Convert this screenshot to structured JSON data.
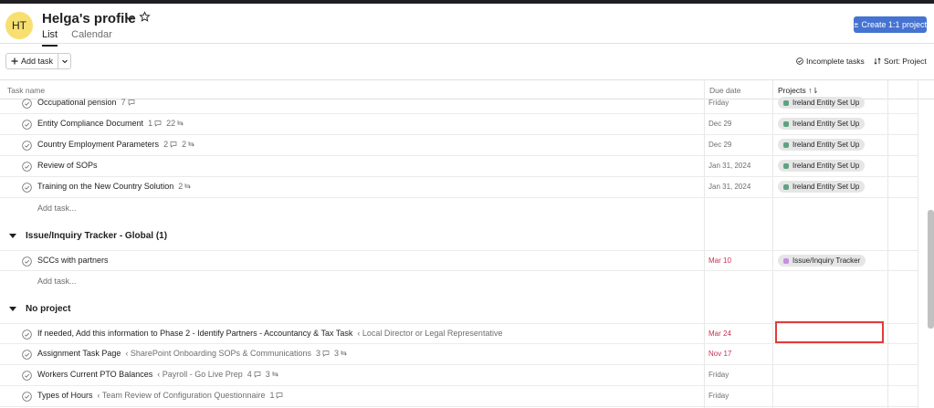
{
  "header": {
    "avatar_initials": "HT",
    "title": "Helga's profile",
    "tabs": [
      {
        "label": "List",
        "active": true
      },
      {
        "label": "Calendar",
        "active": false
      }
    ],
    "create_button_label": "Create 1:1 project"
  },
  "toolbar": {
    "add_task_label": "Add task",
    "filter_label": "Incomplete tasks",
    "sort_label": "Sort: Project"
  },
  "columns": {
    "task_name": "Task name",
    "due_date": "Due date",
    "projects": "Projects"
  },
  "groups": [
    {
      "tasks": [
        {
          "name": "Occupational pension",
          "comments": "7",
          "subtasks": "",
          "due": "Friday",
          "project": "Ireland Entity Set Up"
        },
        {
          "name": "Entity Compliance Document",
          "comments": "1",
          "subtasks": "22",
          "due": "Dec 29",
          "project": "Ireland Entity Set Up"
        },
        {
          "name": "Country Employment Parameters",
          "comments": "2",
          "subtasks": "2",
          "due": "Dec 29",
          "project": "Ireland Entity Set Up"
        },
        {
          "name": "Review of SOPs",
          "comments": "",
          "subtasks": "",
          "due": "Jan 31, 2024",
          "project": "Ireland Entity Set Up"
        },
        {
          "name": "Training on the New Country Solution",
          "comments": "",
          "subtasks": "2",
          "due": "Jan 31, 2024",
          "project": "Ireland Entity Set Up"
        }
      ],
      "add_task": "Add task..."
    },
    {
      "title": "Issue/Inquiry Tracker - Global (1)",
      "tasks": [
        {
          "name": "SCCs with partners",
          "due": "Mar 10",
          "project": "Issue/Inquiry Tracker"
        }
      ],
      "add_task": "Add task..."
    },
    {
      "title": "No project",
      "tasks": [
        {
          "name": "If needed, Add this information to Phase 2 - Identify Partners - Accountancy & Tax Task",
          "parent": "‹ Local Director or Legal Representative",
          "due": "Mar 24"
        },
        {
          "name": "Assignment Task Page",
          "parent": "‹ SharePoint Onboarding SOPs & Communications",
          "comments": "3",
          "subtasks": "3",
          "due": "Nov 17"
        },
        {
          "name": "Workers Current PTO Balances",
          "parent": "‹ Payroll - Go Live Prep",
          "comments": "4",
          "subtasks": "3",
          "due": "Friday"
        },
        {
          "name": "Types of Hours",
          "parent": "‹ Team Review of Configuration Questionnaire",
          "comments": "1",
          "subtasks": "",
          "due": "Friday"
        }
      ]
    }
  ],
  "colors": {
    "primary": "#4573d2",
    "overdue": "#c92f54",
    "ireland_dot": "#5da283",
    "tracker_dot": "#c78ee6",
    "highlight": "#e23b3b"
  }
}
